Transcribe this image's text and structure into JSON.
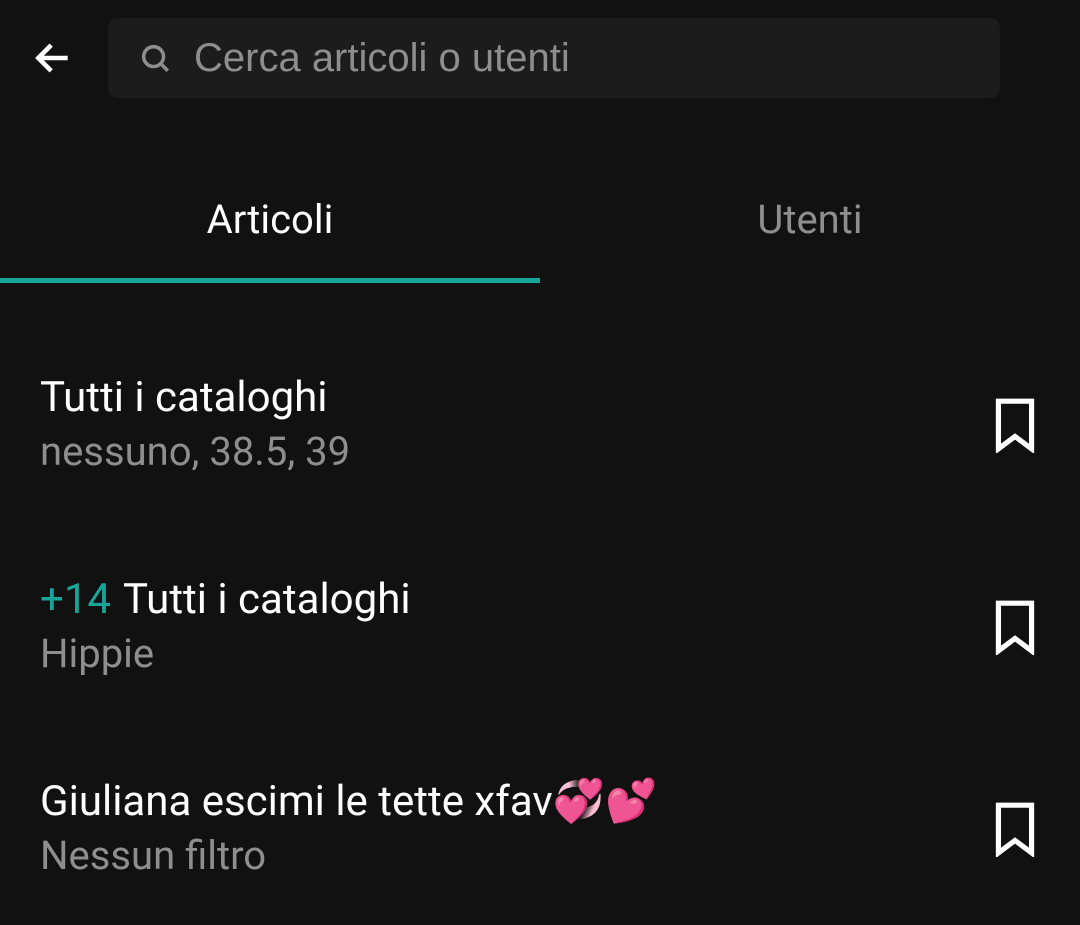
{
  "search": {
    "placeholder": "Cerca articoli o utenti"
  },
  "tabs": {
    "articles": "Articoli",
    "users": "Utenti"
  },
  "items": [
    {
      "badge": "",
      "title": "Tutti i cataloghi",
      "sub": "nessuno, 38.5, 39"
    },
    {
      "badge": "+14",
      "title": "Tutti i cataloghi",
      "sub": "Hippie"
    },
    {
      "badge": "",
      "title": "Giuliana escimi le tette xfav💞💕",
      "sub": "Nessun filtro"
    }
  ]
}
